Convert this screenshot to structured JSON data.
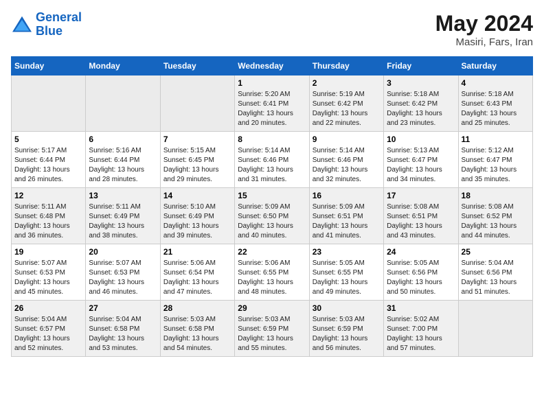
{
  "header": {
    "logo_line1": "General",
    "logo_line2": "Blue",
    "month_year": "May 2024",
    "location": "Masiri, Fars, Iran"
  },
  "weekdays": [
    "Sunday",
    "Monday",
    "Tuesday",
    "Wednesday",
    "Thursday",
    "Friday",
    "Saturday"
  ],
  "weeks": [
    [
      {
        "day": "",
        "info": ""
      },
      {
        "day": "",
        "info": ""
      },
      {
        "day": "",
        "info": ""
      },
      {
        "day": "1",
        "info": "Sunrise: 5:20 AM\nSunset: 6:41 PM\nDaylight: 13 hours\nand 20 minutes."
      },
      {
        "day": "2",
        "info": "Sunrise: 5:19 AM\nSunset: 6:42 PM\nDaylight: 13 hours\nand 22 minutes."
      },
      {
        "day": "3",
        "info": "Sunrise: 5:18 AM\nSunset: 6:42 PM\nDaylight: 13 hours\nand 23 minutes."
      },
      {
        "day": "4",
        "info": "Sunrise: 5:18 AM\nSunset: 6:43 PM\nDaylight: 13 hours\nand 25 minutes."
      }
    ],
    [
      {
        "day": "5",
        "info": "Sunrise: 5:17 AM\nSunset: 6:44 PM\nDaylight: 13 hours\nand 26 minutes."
      },
      {
        "day": "6",
        "info": "Sunrise: 5:16 AM\nSunset: 6:44 PM\nDaylight: 13 hours\nand 28 minutes."
      },
      {
        "day": "7",
        "info": "Sunrise: 5:15 AM\nSunset: 6:45 PM\nDaylight: 13 hours\nand 29 minutes."
      },
      {
        "day": "8",
        "info": "Sunrise: 5:14 AM\nSunset: 6:46 PM\nDaylight: 13 hours\nand 31 minutes."
      },
      {
        "day": "9",
        "info": "Sunrise: 5:14 AM\nSunset: 6:46 PM\nDaylight: 13 hours\nand 32 minutes."
      },
      {
        "day": "10",
        "info": "Sunrise: 5:13 AM\nSunset: 6:47 PM\nDaylight: 13 hours\nand 34 minutes."
      },
      {
        "day": "11",
        "info": "Sunrise: 5:12 AM\nSunset: 6:47 PM\nDaylight: 13 hours\nand 35 minutes."
      }
    ],
    [
      {
        "day": "12",
        "info": "Sunrise: 5:11 AM\nSunset: 6:48 PM\nDaylight: 13 hours\nand 36 minutes."
      },
      {
        "day": "13",
        "info": "Sunrise: 5:11 AM\nSunset: 6:49 PM\nDaylight: 13 hours\nand 38 minutes."
      },
      {
        "day": "14",
        "info": "Sunrise: 5:10 AM\nSunset: 6:49 PM\nDaylight: 13 hours\nand 39 minutes."
      },
      {
        "day": "15",
        "info": "Sunrise: 5:09 AM\nSunset: 6:50 PM\nDaylight: 13 hours\nand 40 minutes."
      },
      {
        "day": "16",
        "info": "Sunrise: 5:09 AM\nSunset: 6:51 PM\nDaylight: 13 hours\nand 41 minutes."
      },
      {
        "day": "17",
        "info": "Sunrise: 5:08 AM\nSunset: 6:51 PM\nDaylight: 13 hours\nand 43 minutes."
      },
      {
        "day": "18",
        "info": "Sunrise: 5:08 AM\nSunset: 6:52 PM\nDaylight: 13 hours\nand 44 minutes."
      }
    ],
    [
      {
        "day": "19",
        "info": "Sunrise: 5:07 AM\nSunset: 6:53 PM\nDaylight: 13 hours\nand 45 minutes."
      },
      {
        "day": "20",
        "info": "Sunrise: 5:07 AM\nSunset: 6:53 PM\nDaylight: 13 hours\nand 46 minutes."
      },
      {
        "day": "21",
        "info": "Sunrise: 5:06 AM\nSunset: 6:54 PM\nDaylight: 13 hours\nand 47 minutes."
      },
      {
        "day": "22",
        "info": "Sunrise: 5:06 AM\nSunset: 6:55 PM\nDaylight: 13 hours\nand 48 minutes."
      },
      {
        "day": "23",
        "info": "Sunrise: 5:05 AM\nSunset: 6:55 PM\nDaylight: 13 hours\nand 49 minutes."
      },
      {
        "day": "24",
        "info": "Sunrise: 5:05 AM\nSunset: 6:56 PM\nDaylight: 13 hours\nand 50 minutes."
      },
      {
        "day": "25",
        "info": "Sunrise: 5:04 AM\nSunset: 6:56 PM\nDaylight: 13 hours\nand 51 minutes."
      }
    ],
    [
      {
        "day": "26",
        "info": "Sunrise: 5:04 AM\nSunset: 6:57 PM\nDaylight: 13 hours\nand 52 minutes."
      },
      {
        "day": "27",
        "info": "Sunrise: 5:04 AM\nSunset: 6:58 PM\nDaylight: 13 hours\nand 53 minutes."
      },
      {
        "day": "28",
        "info": "Sunrise: 5:03 AM\nSunset: 6:58 PM\nDaylight: 13 hours\nand 54 minutes."
      },
      {
        "day": "29",
        "info": "Sunrise: 5:03 AM\nSunset: 6:59 PM\nDaylight: 13 hours\nand 55 minutes."
      },
      {
        "day": "30",
        "info": "Sunrise: 5:03 AM\nSunset: 6:59 PM\nDaylight: 13 hours\nand 56 minutes."
      },
      {
        "day": "31",
        "info": "Sunrise: 5:02 AM\nSunset: 7:00 PM\nDaylight: 13 hours\nand 57 minutes."
      },
      {
        "day": "",
        "info": ""
      }
    ]
  ]
}
